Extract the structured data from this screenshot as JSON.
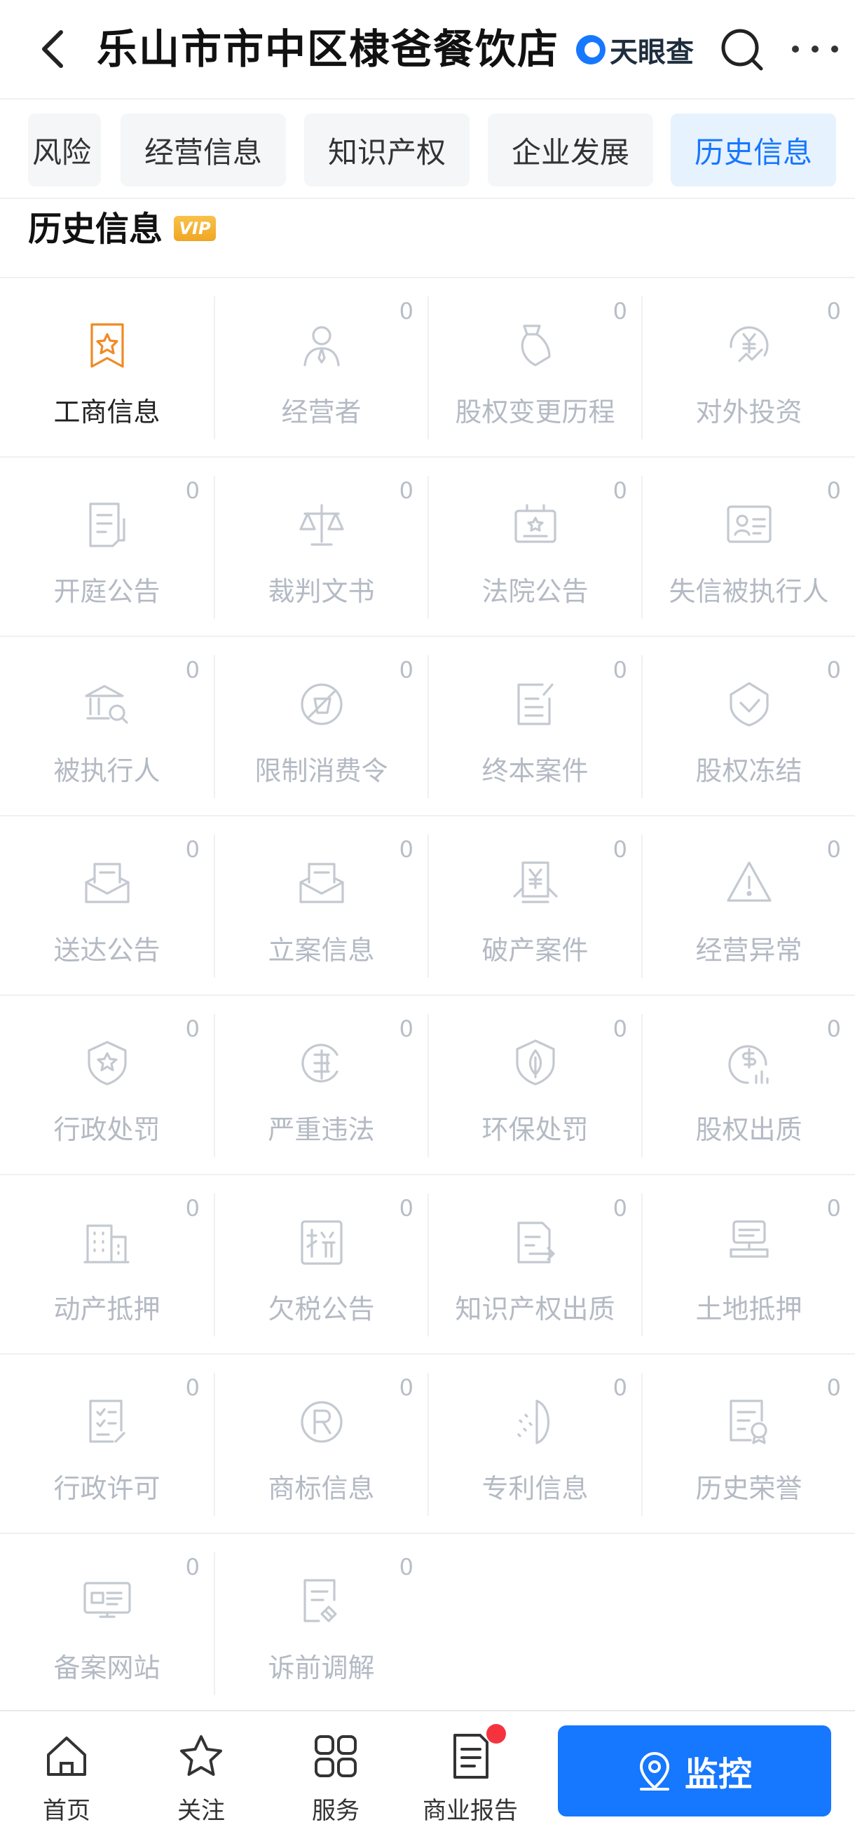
{
  "header": {
    "title": "乐山市市中区棣爸餐饮店",
    "brand": "天眼查"
  },
  "tabs": [
    {
      "label": "风险",
      "active": false
    },
    {
      "label": "经营信息",
      "active": false
    },
    {
      "label": "知识产权",
      "active": false
    },
    {
      "label": "企业发展",
      "active": false
    },
    {
      "label": "历史信息",
      "active": true
    }
  ],
  "section": {
    "title": "历史信息",
    "badge": "VIP"
  },
  "grid": [
    {
      "label": "工商信息",
      "count": "",
      "icon": "bookmark-star-icon",
      "active": true
    },
    {
      "label": "经营者",
      "count": "0",
      "icon": "person-icon",
      "active": false
    },
    {
      "label": "股权变更历程",
      "count": "0",
      "icon": "equity-change-icon",
      "active": false
    },
    {
      "label": "对外投资",
      "count": "0",
      "icon": "investment-icon",
      "active": false
    },
    {
      "label": "开庭公告",
      "count": "0",
      "icon": "court-notice-icon",
      "active": false
    },
    {
      "label": "裁判文书",
      "count": "0",
      "icon": "scales-icon",
      "active": false
    },
    {
      "label": "法院公告",
      "count": "0",
      "icon": "court-board-icon",
      "active": false
    },
    {
      "label": "失信被执行人",
      "count": "0",
      "icon": "id-card-icon",
      "active": false
    },
    {
      "label": "被执行人",
      "count": "0",
      "icon": "bank-search-icon",
      "active": false
    },
    {
      "label": "限制消费令",
      "count": "0",
      "icon": "no-shopping-icon",
      "active": false
    },
    {
      "label": "终本案件",
      "count": "0",
      "icon": "document-edit-icon",
      "active": false
    },
    {
      "label": "股权冻结",
      "count": "0",
      "icon": "shield-icon",
      "active": false
    },
    {
      "label": "送达公告",
      "count": "0",
      "icon": "mail-tray-icon",
      "active": false
    },
    {
      "label": "立案信息",
      "count": "0",
      "icon": "mail-tray-icon",
      "active": false
    },
    {
      "label": "破产案件",
      "count": "0",
      "icon": "bankruptcy-icon",
      "active": false
    },
    {
      "label": "经营异常",
      "count": "0",
      "icon": "warning-icon",
      "active": false
    },
    {
      "label": "行政处罚",
      "count": "0",
      "icon": "shield-star-icon",
      "active": false
    },
    {
      "label": "严重违法",
      "count": "0",
      "icon": "violation-icon",
      "active": false
    },
    {
      "label": "环保处罚",
      "count": "0",
      "icon": "leaf-shield-icon",
      "active": false
    },
    {
      "label": "股权出质",
      "count": "0",
      "icon": "money-chart-icon",
      "active": false
    },
    {
      "label": "动产抵押",
      "count": "0",
      "icon": "building-icon",
      "active": false
    },
    {
      "label": "欠税公告",
      "count": "0",
      "icon": "tax-icon",
      "active": false
    },
    {
      "label": "知识产权出质",
      "count": "0",
      "icon": "document-arrow-icon",
      "active": false
    },
    {
      "label": "土地抵押",
      "count": "0",
      "icon": "land-stamp-icon",
      "active": false
    },
    {
      "label": "行政许可",
      "count": "0",
      "icon": "checklist-icon",
      "active": false
    },
    {
      "label": "商标信息",
      "count": "0",
      "icon": "registered-icon",
      "active": false
    },
    {
      "label": "专利信息",
      "count": "0",
      "icon": "patent-icon",
      "active": false
    },
    {
      "label": "历史荣誉",
      "count": "0",
      "icon": "certificate-icon",
      "active": false
    },
    {
      "label": "备案网站",
      "count": "0",
      "icon": "website-icon",
      "active": false
    },
    {
      "label": "诉前调解",
      "count": "0",
      "icon": "handshake-doc-icon",
      "active": false
    }
  ],
  "bottom_nav": {
    "items": [
      {
        "label": "首页",
        "icon": "home-icon"
      },
      {
        "label": "关注",
        "icon": "star-icon"
      },
      {
        "label": "服务",
        "icon": "grid-icon"
      },
      {
        "label": "商业报告",
        "icon": "report-icon"
      }
    ],
    "monitor_label": "监控"
  },
  "colors": {
    "accent": "#1677ff",
    "active_tab_bg": "#e6f2fe",
    "vip": "#f0a624",
    "inactive_text": "#b4bac4",
    "active_icon": "#f08a24",
    "badge_dot": "#f5333f"
  }
}
